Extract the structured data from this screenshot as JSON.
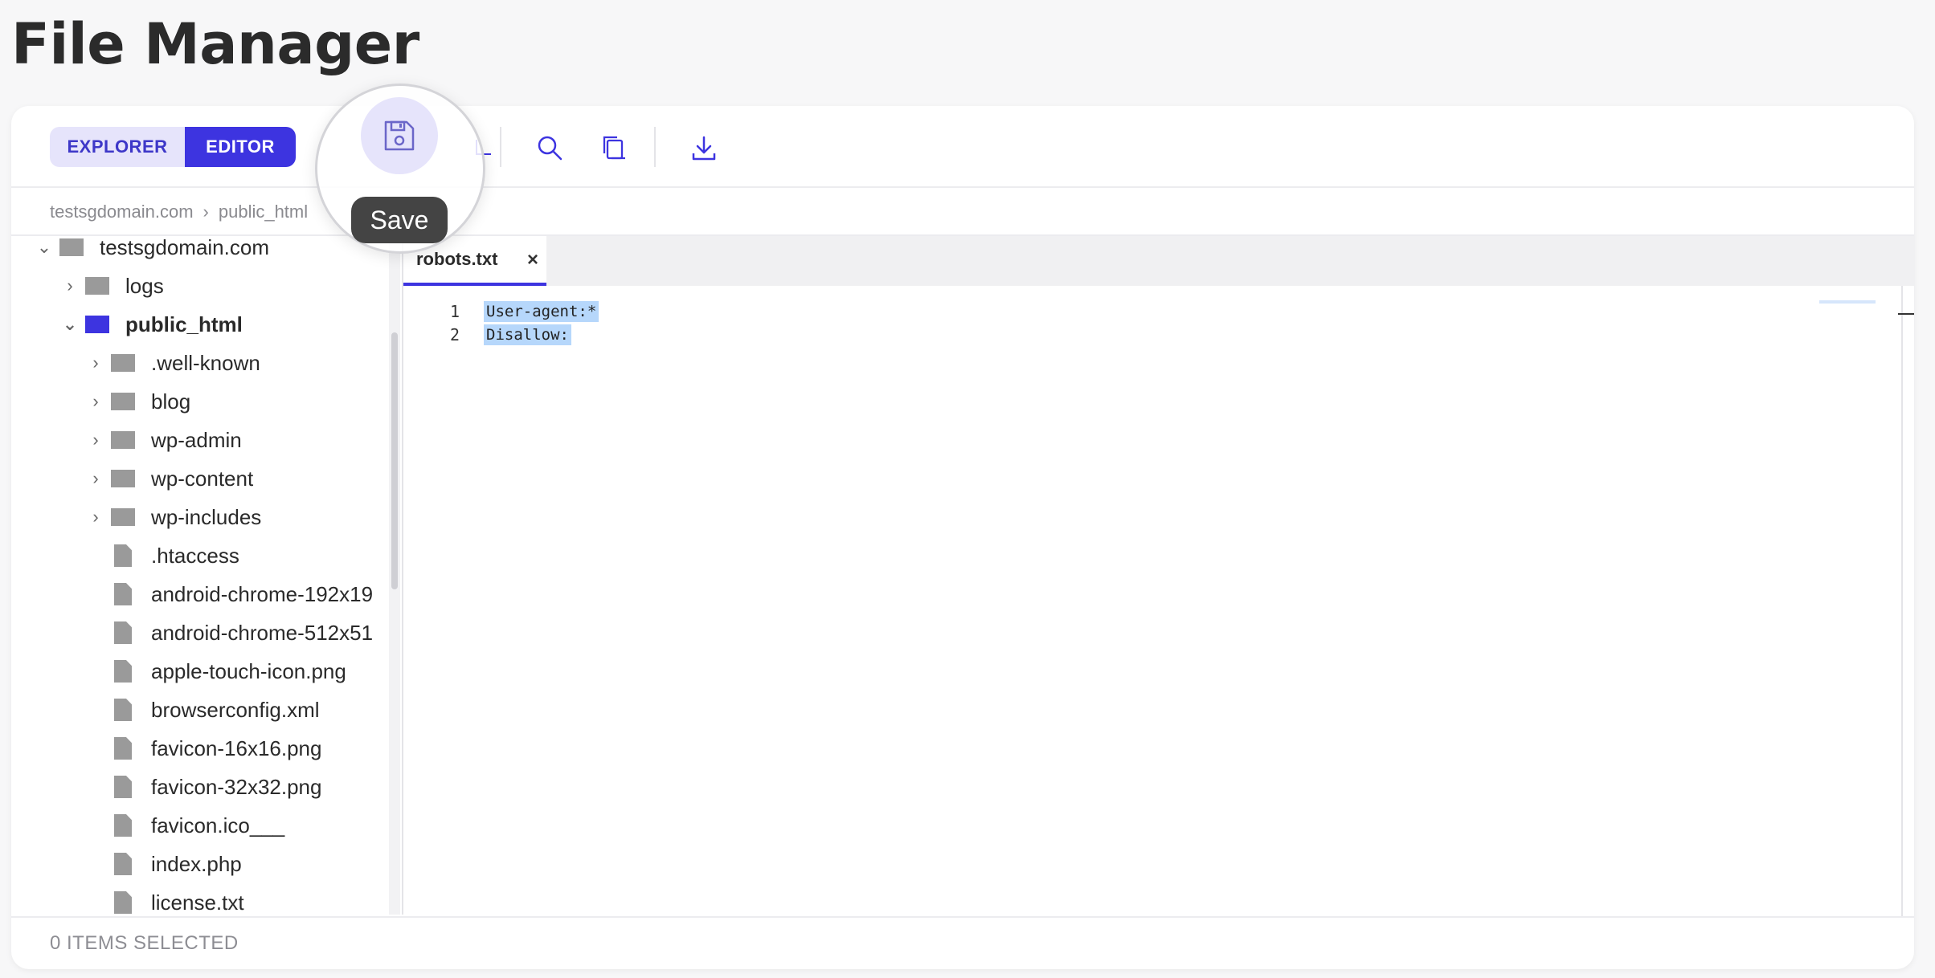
{
  "page": {
    "title": "File Manager"
  },
  "toolbar": {
    "view_toggle": {
      "explorer_label": "EXPLORER",
      "editor_label": "EDITOR",
      "active": "EDITOR"
    },
    "icons": [
      "save-icon",
      "search-icon",
      "copy-icon",
      "download-icon"
    ],
    "tooltip": "Save"
  },
  "breadcrumb": [
    "testsgdomain.com",
    "public_html"
  ],
  "tree": {
    "root": "testsgdomain.com",
    "items": [
      {
        "label": "logs",
        "type": "folder"
      },
      {
        "label": "public_html",
        "type": "folder",
        "expanded": true
      },
      {
        "label": ".well-known",
        "type": "folder"
      },
      {
        "label": "blog",
        "type": "folder"
      },
      {
        "label": "wp-admin",
        "type": "folder"
      },
      {
        "label": "wp-content",
        "type": "folder"
      },
      {
        "label": "wp-includes",
        "type": "folder"
      },
      {
        "label": ".htaccess",
        "type": "file"
      },
      {
        "label": "android-chrome-192x19",
        "type": "file"
      },
      {
        "label": "android-chrome-512x51",
        "type": "file"
      },
      {
        "label": "apple-touch-icon.png",
        "type": "file"
      },
      {
        "label": "browserconfig.xml",
        "type": "file"
      },
      {
        "label": "favicon-16x16.png",
        "type": "file"
      },
      {
        "label": "favicon-32x32.png",
        "type": "file"
      },
      {
        "label": "favicon.ico___",
        "type": "file"
      },
      {
        "label": "index.php",
        "type": "file"
      },
      {
        "label": "license.txt",
        "type": "file"
      }
    ]
  },
  "editor": {
    "tab_label": "robots.txt",
    "close_label": "×",
    "line_numbers": [
      "1",
      "2"
    ],
    "lines": [
      "User-agent:*",
      "Disallow:"
    ]
  },
  "footer": {
    "status": "0 ITEMS SELECTED"
  },
  "colors": {
    "accent": "#3d34e0",
    "accent_light": "#e6e4fb",
    "selection": "#b6d7fb",
    "folder": "#9a9a9a",
    "folder_active": "#3d34e0"
  }
}
